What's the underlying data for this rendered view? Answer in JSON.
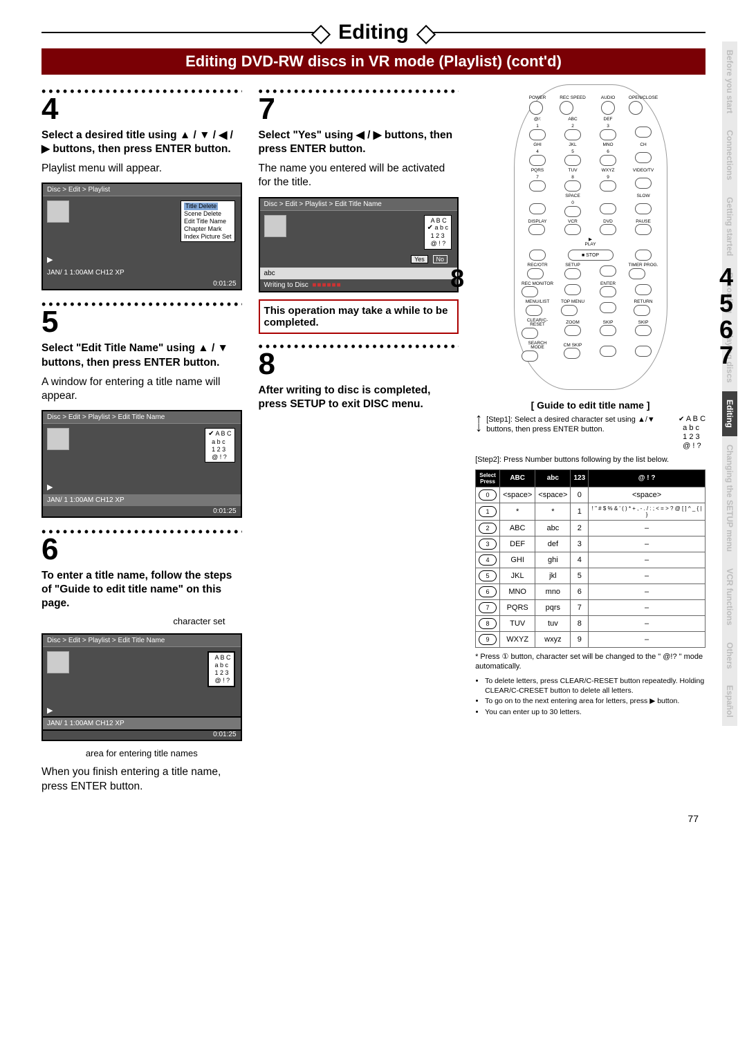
{
  "header": {
    "title": "Editing",
    "subtitle": "Editing DVD-RW discs in VR mode (Playlist) (cont'd)"
  },
  "side_tabs": [
    "Before you start",
    "Connections",
    "Getting started",
    "Recording",
    "Playing discs",
    "Editing",
    "Changing the SETUP menu",
    "VCR functions",
    "Others",
    "Español"
  ],
  "side_active": "Editing",
  "steps": {
    "s4": {
      "num": "4",
      "bold": "Select a desired title using ▲ / ▼ / ◀ / ▶ buttons, then press ENTER button.",
      "plain": "Playlist menu will appear."
    },
    "s5": {
      "num": "5",
      "bold": "Select \"Edit Title Name\" using ▲ / ▼ buttons, then press ENTER button.",
      "plain": "A window for entering a title name will appear."
    },
    "s6": {
      "num": "6",
      "bold": "To enter a title name, follow the steps of \"Guide to edit title name\" on this page.",
      "charset": "character set",
      "area": "area for entering title names",
      "after": "When you finish entering a title name, press ENTER button."
    },
    "s7": {
      "num": "7",
      "bold": "Select \"Yes\" using ◀ / ▶ buttons, then press ENTER button.",
      "plain": "The name you entered will be activated for the title.",
      "red": "This operation may take a while to be completed."
    },
    "s8": {
      "num": "8",
      "bold": "After writing to disc is completed, press SETUP to exit DISC menu."
    }
  },
  "screens": {
    "sc4": {
      "bc": "Disc > Edit > Playlist",
      "menu": [
        "Title Delete",
        "Scene Delete",
        "Edit Title Name",
        "Chapter Mark",
        "Index Picture Set"
      ],
      "menu_hi": "Title Delete",
      "footer": "JAN/ 1  1:00AM  CH12   XP",
      "timer": "0:01:25"
    },
    "sc5": {
      "bc": "Disc > Edit > Playlist > Edit Title Name",
      "charset": [
        "A B C",
        "a b c",
        "1 2 3",
        "@ ! ?"
      ],
      "check_row": 0,
      "footer": "JAN/ 1  1:00AM  CH12   XP",
      "timer": "0:01:25"
    },
    "sc6": {
      "bc": "Disc > Edit  > Playlist > Edit Title Name",
      "charset": [
        "A B C",
        "a b c",
        "1 2 3",
        "@ ! ?"
      ],
      "footer": "JAN/ 1  1:00AM  CH12   XP",
      "timer": "0:01:25"
    },
    "sc7": {
      "bc": "Disc > Edit > Playlist > Edit Title Name",
      "charset": [
        "A B C",
        "a b c",
        "1 2 3",
        "@ ! ?"
      ],
      "check_row": 1,
      "yes": "Yes",
      "no": "No",
      "entry": "abc",
      "writing": "Writing to Disc",
      "progress": "■■■■■■"
    }
  },
  "remote_callouts": {
    "left": "8",
    "right": [
      "4",
      "5",
      "6",
      "7"
    ]
  },
  "remote_labels": {
    "row0": [
      "POWER",
      "REC SPEED",
      "AUDIO",
      "OPEN/CLOSE"
    ],
    "row1": [
      "@/:",
      "ABC",
      "DEF",
      ""
    ],
    "num1": [
      "1",
      "2",
      "3",
      ""
    ],
    "row2": [
      "GHI",
      "JKL",
      "MNO",
      "CH"
    ],
    "num2": [
      "4",
      "5",
      "6",
      ""
    ],
    "row3": [
      "PQRS",
      "TUV",
      "WXYZ",
      "VIDEO/TV"
    ],
    "num3": [
      "7",
      "8",
      "9",
      ""
    ],
    "row4": [
      "",
      "SPACE",
      "",
      "SLOW"
    ],
    "num4": [
      "",
      "0",
      "",
      ""
    ],
    "row5": [
      "DISPLAY",
      "VCR",
      "DVD",
      "PAUSE"
    ],
    "play": "PLAY",
    "stop": "STOP",
    "row6": [
      "REC/OTR",
      "SETUP",
      "",
      "TIMER PROG."
    ],
    "row7": [
      "REC MONITOR",
      "",
      "ENTER",
      ""
    ],
    "row8": [
      "MENU/LIST",
      "TOP MENU",
      "",
      "RETURN"
    ],
    "row9": [
      "CLEAR/C-RESET",
      "ZOOM",
      "SKIP",
      "SKIP"
    ],
    "row10": [
      "SEARCH MODE",
      "CM SKIP",
      "",
      ""
    ]
  },
  "guide": {
    "title": "[ Guide to edit title name ]",
    "step1": "[Step1]: Select a desired character set using ▲/▼ buttons, then press ENTER button.",
    "step1_sets": [
      "A B C",
      "a b c",
      "1 2 3",
      "@ ! ?"
    ],
    "step2": "[Step2]: Press Number buttons following by the list below.",
    "table_headers": [
      "",
      "ABC",
      "abc",
      "123",
      "@ ! ?"
    ],
    "corner": {
      "top": "Select",
      "bottom": "Press"
    },
    "rows": [
      {
        "p": "0",
        "c": [
          "<space>",
          "<space>",
          "0",
          "<space>"
        ]
      },
      {
        "p": "1",
        "c": [
          "*",
          "*",
          "1",
          "! \" # $ % & ' ( ) * + , - . / : ; < = > ? @ [ ] ^ _ { | }"
        ]
      },
      {
        "p": "2",
        "c": [
          "ABC",
          "abc",
          "2",
          "–"
        ]
      },
      {
        "p": "3",
        "c": [
          "DEF",
          "def",
          "3",
          "–"
        ]
      },
      {
        "p": "4",
        "c": [
          "GHI",
          "ghi",
          "4",
          "–"
        ]
      },
      {
        "p": "5",
        "c": [
          "JKL",
          "jkl",
          "5",
          "–"
        ]
      },
      {
        "p": "6",
        "c": [
          "MNO",
          "mno",
          "6",
          "–"
        ]
      },
      {
        "p": "7",
        "c": [
          "PQRS",
          "pqrs",
          "7",
          "–"
        ]
      },
      {
        "p": "8",
        "c": [
          "TUV",
          "tuv",
          "8",
          "–"
        ]
      },
      {
        "p": "9",
        "c": [
          "WXYZ",
          "wxyz",
          "9",
          "–"
        ]
      }
    ],
    "asterisk": "* Press ① button, character set will be changed to the \" @!? \" mode automatically.",
    "notes": [
      "To delete letters, press CLEAR/C-RESET button repeatedly. Holding CLEAR/C-CRESET button to delete all letters.",
      "To go on to the next entering area for letters, press ▶ button.",
      "You can enter up to 30 letters."
    ]
  },
  "page_number": "77"
}
